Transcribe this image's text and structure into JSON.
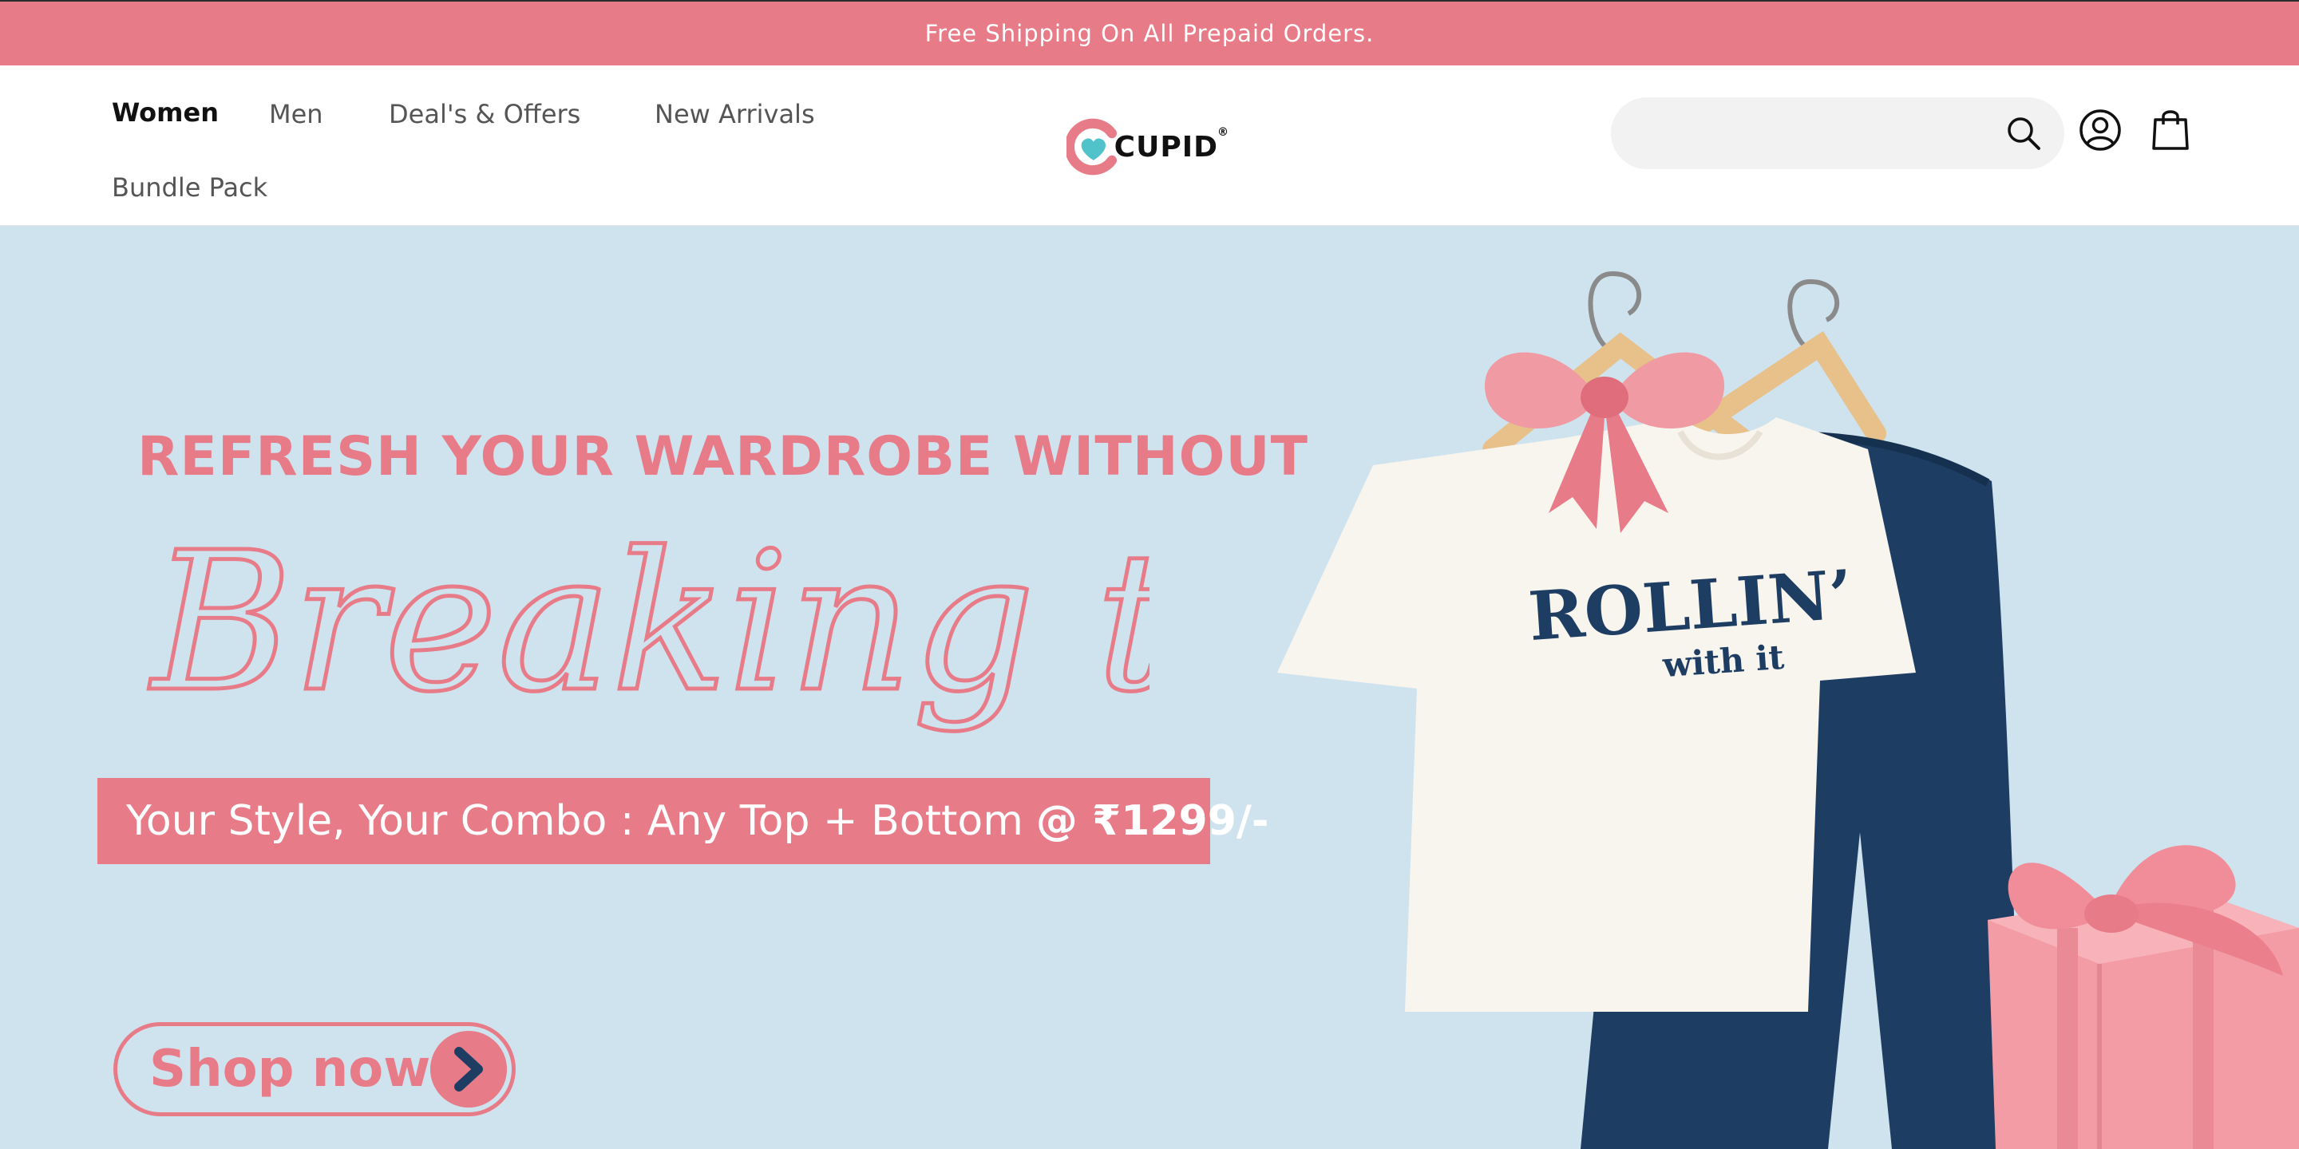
{
  "announcement": {
    "text": "Free Shipping On All Prepaid Orders."
  },
  "nav": {
    "items": [
      {
        "label": "Women"
      },
      {
        "label": "Men"
      },
      {
        "label": "Deal's & Offers"
      },
      {
        "label": "New Arrivals"
      },
      {
        "label": "Bundle Pack"
      }
    ],
    "active": "Women"
  },
  "logo": {
    "text": "CUPID",
    "mark": "®"
  },
  "search": {
    "placeholder": "",
    "value": ""
  },
  "icons": {
    "search": "search-icon",
    "account": "user-icon",
    "cart": "shopping-bag-icon"
  },
  "hero": {
    "headline": "REFRESH YOUR WARDROBE WITHOUT",
    "script": "Breaking the Bank",
    "combo_text": "Your Style, Your Combo : Any Top + Bottom",
    "combo_price": "@ ₹1299/-",
    "cta_label": "Shop now",
    "tshirt_line1": "ROLLIN’",
    "tshirt_line2": "with it"
  },
  "colors": {
    "brand_pink": "#e87b88",
    "hero_bg": "#cfe3ef",
    "navy": "#1e3d63",
    "logo_teal": "#4fc3c9"
  }
}
